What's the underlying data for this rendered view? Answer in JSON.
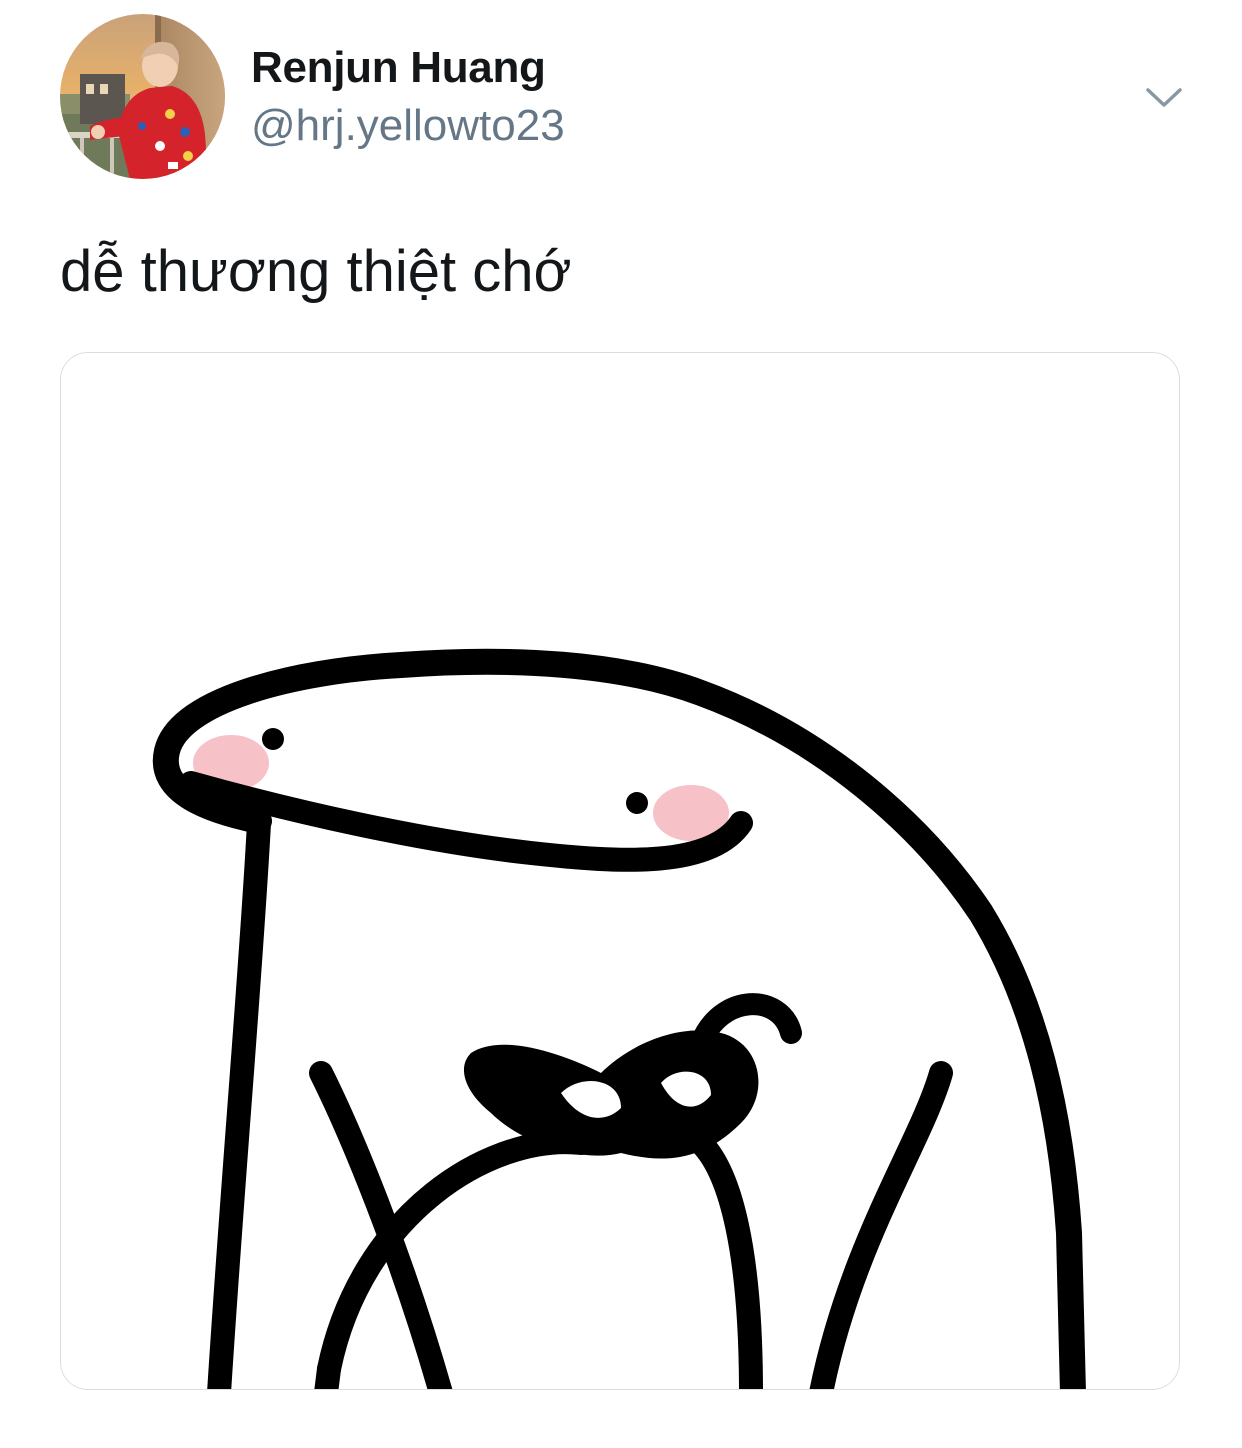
{
  "tweet": {
    "author": {
      "display_name": "Renjun Huang",
      "handle": "@hrj.yellowto23"
    },
    "text": "dễ thương thiệt chớ",
    "menu_icon": "chevron-down-icon",
    "media": {
      "kind": "image",
      "description_icon": "flork-heart-hands-meme"
    }
  },
  "colors": {
    "text_primary": "#14171a",
    "text_secondary": "#657786",
    "caret": "#8899a6",
    "media_border": "#d8dde2",
    "avatar_jacket": "#d4232a",
    "blush": "#f4b6bd"
  }
}
